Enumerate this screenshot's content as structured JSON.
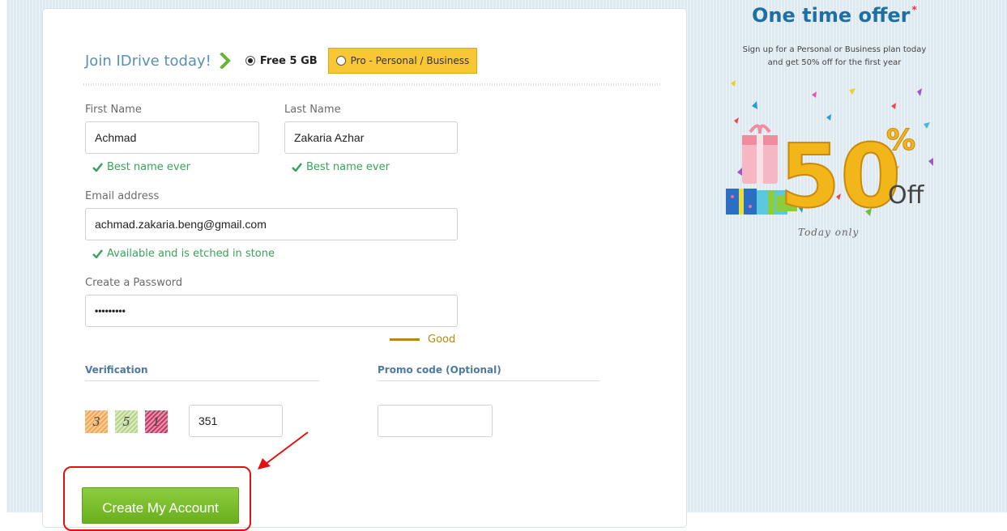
{
  "signup": {
    "join_title": "Join IDrive today!",
    "plan_free_label": "Free 5 GB",
    "plan_pro_label": "Pro - Personal / Business",
    "first_name_label": "First Name",
    "first_name_value": "Achmad",
    "first_name_msg": "Best name ever",
    "last_name_label": "Last Name",
    "last_name_value": "Zakaria Azhar",
    "last_name_msg": "Best name ever",
    "email_label": "Email address",
    "email_value": "achmad.zakaria.beng@gmail.com",
    "email_msg": "Available and is etched in stone",
    "password_label": "Create a Password",
    "password_value": "•••••••••",
    "password_strength": "Good",
    "verification_heading": "Verification",
    "captcha_digits": [
      "3",
      "5",
      "1"
    ],
    "captcha_value": "351",
    "promo_heading": "Promo code (Optional)",
    "promo_value": "",
    "create_button": "Create My Account"
  },
  "offer": {
    "title": "One time offer",
    "asterisk": "*",
    "subtitle_line1": "Sign up for a Personal or Business plan today",
    "subtitle_line2": "and get 50% off for the first year",
    "badge_number": "50",
    "badge_percent": "%",
    "badge_off": "Off",
    "today_only": "Today only"
  },
  "colors": {
    "accent_blue": "#1f6fa3",
    "success_green": "#38a35a",
    "button_green": "#7cbf30",
    "pro_yellow": "#f9c634",
    "annotation_red": "#e41010"
  },
  "icons": [
    "chevron-right-icon",
    "radio-selected-icon",
    "radio-unselected-icon",
    "checkmark-icon",
    "arrow-annotation"
  ]
}
